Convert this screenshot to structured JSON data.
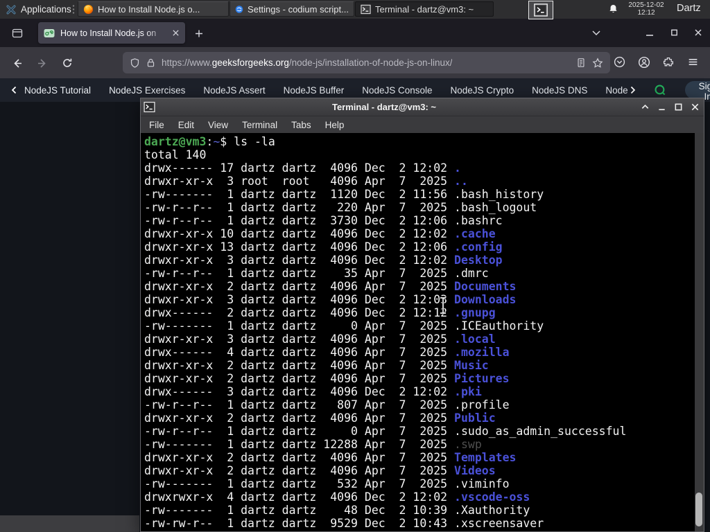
{
  "panel": {
    "applications": "Applications",
    "windows": [
      {
        "title": "How to Install Node.js o...",
        "icon": "firefox-icon"
      },
      {
        "title": "Settings - codium script...",
        "icon": "codium-icon"
      },
      {
        "title": "Terminal - dartz@vm3: ~",
        "icon": "terminal-icon",
        "active": true
      }
    ],
    "clock": {
      "date": "2025-12-02",
      "time": "12:12"
    },
    "user": "Dartz"
  },
  "browser": {
    "tab": {
      "title": "How to Install Node.js on"
    },
    "urlbar": {
      "scheme": "https://www.",
      "domain": "geeksforgeeks.org",
      "path": "/node-js/installation-of-node-js-on-linux/"
    },
    "nav": {
      "items": [
        "NodeJS Tutorial",
        "NodeJS Exercises",
        "NodeJS Assert",
        "NodeJS Buffer",
        "NodeJS Console",
        "NodeJS Crypto",
        "NodeJS DNS",
        "Node"
      ],
      "sign_in": "Sign In"
    }
  },
  "terminal": {
    "title": "Terminal - dartz@vm3: ~",
    "menu": [
      "File",
      "Edit",
      "View",
      "Terminal",
      "Tabs",
      "Help"
    ],
    "prompt": {
      "user_host": "dartz@vm3",
      "colon": ":",
      "path": "~",
      "command": "$ ls -la"
    },
    "total": "total 140",
    "rows": [
      {
        "p": "drwx------ 17 dartz dartz  4096 Dec  2 12:02 ",
        "n": ".",
        "t": "d"
      },
      {
        "p": "drwxr-xr-x  3 root  root   4096 Apr  7  2025 ",
        "n": "..",
        "t": "d"
      },
      {
        "p": "-rw-------  1 dartz dartz  1120 Dec  2 11:56 ",
        "n": ".bash_history",
        "t": "f"
      },
      {
        "p": "-rw-r--r--  1 dartz dartz   220 Apr  7  2025 ",
        "n": ".bash_logout",
        "t": "f"
      },
      {
        "p": "-rw-r--r--  1 dartz dartz  3730 Dec  2 12:06 ",
        "n": ".bashrc",
        "t": "f"
      },
      {
        "p": "drwxr-xr-x 10 dartz dartz  4096 Dec  2 12:02 ",
        "n": ".cache",
        "t": "d"
      },
      {
        "p": "drwxr-xr-x 13 dartz dartz  4096 Dec  2 12:06 ",
        "n": ".config",
        "t": "d"
      },
      {
        "p": "drwxr-xr-x  3 dartz dartz  4096 Dec  2 12:02 ",
        "n": "Desktop",
        "t": "d"
      },
      {
        "p": "-rw-r--r--  1 dartz dartz    35 Apr  7  2025 ",
        "n": ".dmrc",
        "t": "f"
      },
      {
        "p": "drwxr-xr-x  2 dartz dartz  4096 Apr  7  2025 ",
        "n": "Documents",
        "t": "d"
      },
      {
        "p": "drwxr-xr-x  3 dartz dartz  4096 Dec  2 12:03 ",
        "n": "Downloads",
        "t": "d"
      },
      {
        "p": "drwx------  2 dartz dartz  4096 Dec  2 12:12 ",
        "n": ".gnupg",
        "t": "d"
      },
      {
        "p": "-rw-------  1 dartz dartz     0 Apr  7  2025 ",
        "n": ".ICEauthority",
        "t": "f"
      },
      {
        "p": "drwxr-xr-x  3 dartz dartz  4096 Apr  7  2025 ",
        "n": ".local",
        "t": "d"
      },
      {
        "p": "drwx------  4 dartz dartz  4096 Apr  7  2025 ",
        "n": ".mozilla",
        "t": "d"
      },
      {
        "p": "drwxr-xr-x  2 dartz dartz  4096 Apr  7  2025 ",
        "n": "Music",
        "t": "d"
      },
      {
        "p": "drwxr-xr-x  2 dartz dartz  4096 Apr  7  2025 ",
        "n": "Pictures",
        "t": "d"
      },
      {
        "p": "drwx------  3 dartz dartz  4096 Dec  2 12:02 ",
        "n": ".pki",
        "t": "d"
      },
      {
        "p": "-rw-r--r--  1 dartz dartz   807 Apr  7  2025 ",
        "n": ".profile",
        "t": "f"
      },
      {
        "p": "drwxr-xr-x  2 dartz dartz  4096 Apr  7  2025 ",
        "n": "Public",
        "t": "d"
      },
      {
        "p": "-rw-r--r--  1 dartz dartz     0 Apr  7  2025 ",
        "n": ".sudo_as_admin_successful",
        "t": "f"
      },
      {
        "p": "-rw-------  1 dartz dartz 12288 Apr  7  2025 ",
        "n": ".swp",
        "t": "x"
      },
      {
        "p": "drwxr-xr-x  2 dartz dartz  4096 Apr  7  2025 ",
        "n": "Templates",
        "t": "d"
      },
      {
        "p": "drwxr-xr-x  2 dartz dartz  4096 Apr  7  2025 ",
        "n": "Videos",
        "t": "d"
      },
      {
        "p": "-rw-------  1 dartz dartz   532 Apr  7  2025 ",
        "n": ".viminfo",
        "t": "f"
      },
      {
        "p": "drwxrwxr-x  4 dartz dartz  4096 Dec  2 12:02 ",
        "n": ".vscode-oss",
        "t": "d"
      },
      {
        "p": "-rw-------  1 dartz dartz    48 Dec  2 10:39 ",
        "n": ".Xauthority",
        "t": "f"
      },
      {
        "p": "-rw-rw-r--  1 dartz dartz  9529 Dec  2 10:43 ",
        "n": ".xscreensaver",
        "t": "f"
      }
    ]
  },
  "colors": {
    "term_green": "#4ca954",
    "term_dir_blue": "#4a51d8",
    "term_path_blue": "#5a62cf",
    "term_dim": "#4f4f4f",
    "gfg_green": "#23b15c",
    "firefox_orange": "#ff9800",
    "codium_blue": "#2f80ed"
  }
}
